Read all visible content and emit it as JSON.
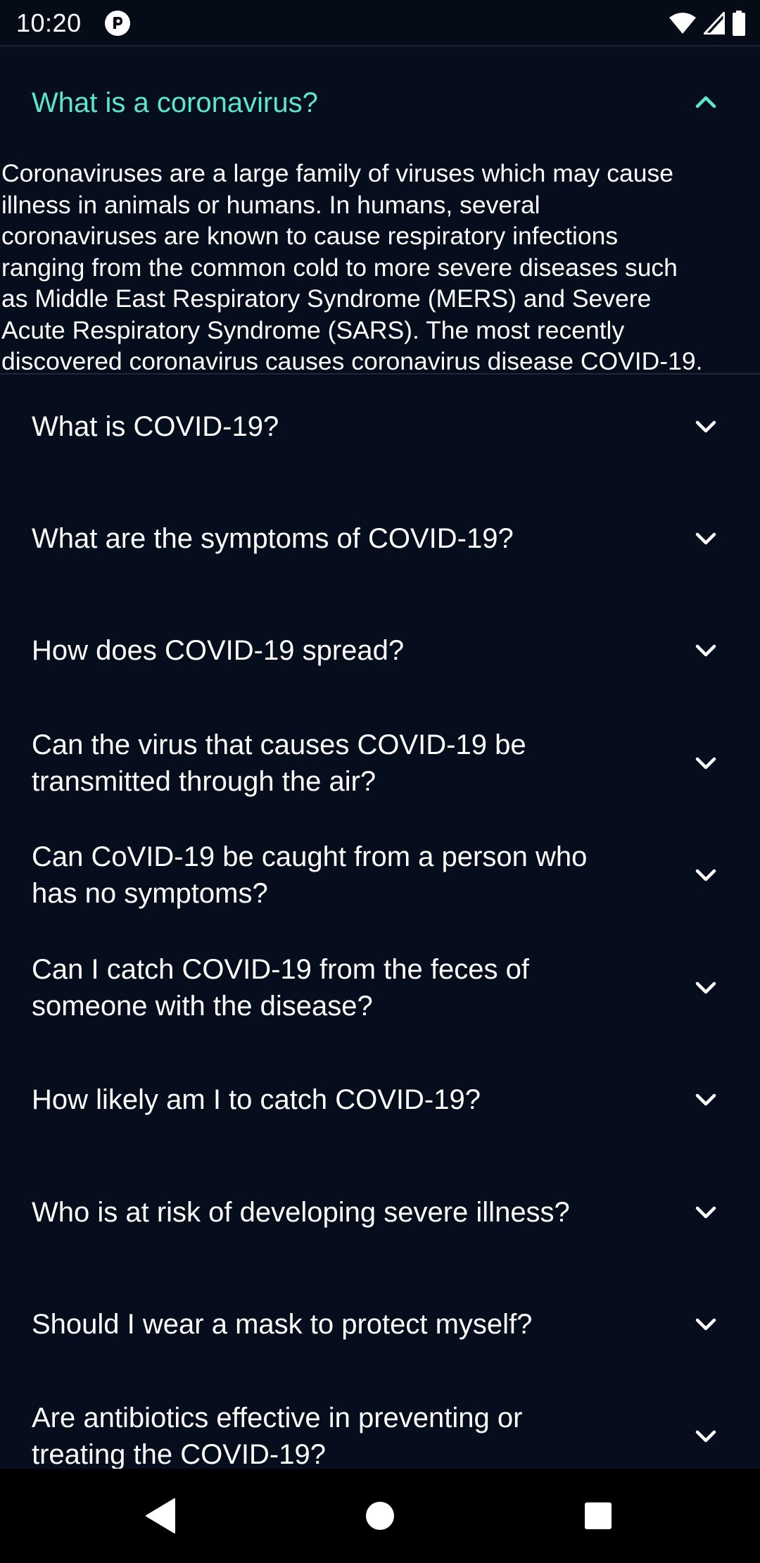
{
  "status_bar": {
    "time": "10:20",
    "app_icon": "app-notification-icon",
    "icons": [
      "wifi-icon",
      "signal-icon",
      "battery-icon"
    ]
  },
  "colors": {
    "background": "#060e1e",
    "accent": "#5be8c8",
    "text": "#ffffff"
  },
  "faq": {
    "open_item": {
      "question": "What is a coronavirus?",
      "icon": "chevron-up-icon",
      "answer_lines": [
        "Coronaviruses are a large family of viruses which may cause",
        "illness in animals or humans.  In humans, several",
        "coronaviruses are known to cause respiratory infections",
        "ranging from the common cold to more severe diseases such",
        "as Middle East Respiratory Syndrome (MERS) and Severe",
        "Acute Respiratory Syndrome (SARS). The most recently",
        "discovered coronavirus causes coronavirus disease COVID-19."
      ]
    },
    "items": [
      {
        "lines": [
          "What is COVID-19?"
        ],
        "icon": "chevron-down-icon"
      },
      {
        "lines": [
          "What are the symptoms of COVID-19?"
        ],
        "icon": "chevron-down-icon"
      },
      {
        "lines": [
          "How does COVID-19 spread?"
        ],
        "icon": "chevron-down-icon"
      },
      {
        "lines": [
          "Can the virus that causes COVID-19 be",
          "transmitted through the air?"
        ],
        "icon": "chevron-down-icon"
      },
      {
        "lines": [
          "Can CoVID-19 be caught from a person who",
          "has no symptoms?"
        ],
        "icon": "chevron-down-icon"
      },
      {
        "lines": [
          "Can I catch COVID-19 from the feces of",
          "someone with the disease?"
        ],
        "icon": "chevron-down-icon"
      },
      {
        "lines": [
          "How likely am I to catch COVID-19?"
        ],
        "icon": "chevron-down-icon"
      },
      {
        "lines": [
          "Who is at risk of developing severe illness?"
        ],
        "icon": "chevron-down-icon"
      },
      {
        "lines": [
          "Should I wear a mask to protect myself?"
        ],
        "icon": "chevron-down-icon"
      },
      {
        "lines": [
          "Are antibiotics effective in preventing or",
          "treating the COVID-19?"
        ],
        "icon": "chevron-down-icon"
      }
    ]
  },
  "nav_bar": {
    "buttons": [
      "back-icon",
      "home-icon",
      "recents-icon"
    ]
  }
}
